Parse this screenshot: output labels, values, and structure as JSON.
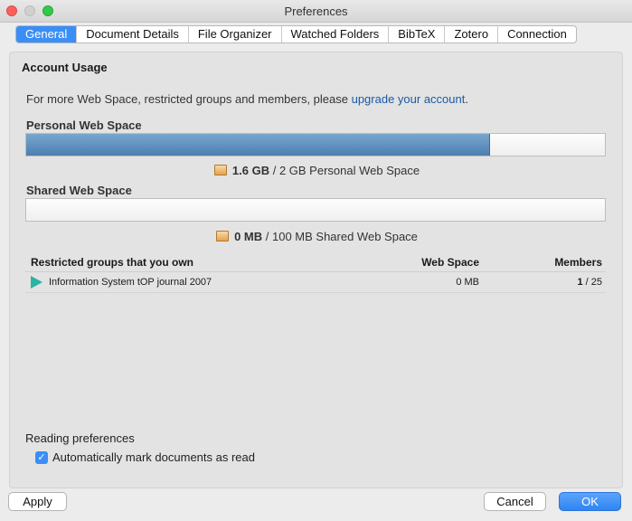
{
  "window": {
    "title": "Preferences"
  },
  "tabs": [
    {
      "label": "General",
      "active": true
    },
    {
      "label": "Document Details"
    },
    {
      "label": "File Organizer"
    },
    {
      "label": "Watched Folders"
    },
    {
      "label": "BibTeX"
    },
    {
      "label": "Zotero"
    },
    {
      "label": "Connection"
    }
  ],
  "account": {
    "title": "Account Usage",
    "intro_text": "For more Web Space, restricted groups and members, please ",
    "upgrade_link": "upgrade your account",
    "intro_end": "."
  },
  "personal": {
    "label": "Personal Web Space",
    "used": "1.6 GB",
    "rest": " / 2 GB Personal Web Space",
    "fraction": 0.8
  },
  "shared": {
    "label": "Shared Web Space",
    "used": "0 MB",
    "rest": " / 100 MB Shared Web Space",
    "fraction": 0
  },
  "groups": {
    "headers": {
      "name": "Restricted groups that you own",
      "space": "Web Space",
      "members": "Members"
    },
    "rows": [
      {
        "name": "Information System tOP journal 2007",
        "space": "0 MB",
        "members_count": "1",
        "members_total": " / 25"
      }
    ]
  },
  "reading": {
    "label": "Reading preferences",
    "checkbox_label": "Automatically mark documents as read",
    "checked": true
  },
  "buttons": {
    "apply": "Apply",
    "cancel": "Cancel",
    "ok": "OK"
  },
  "colors": {
    "accent": "#3a8ef5",
    "bar_fill": "#5a8ebf",
    "link": "#1a5aa6",
    "group_icon": "#2bb3a3"
  }
}
